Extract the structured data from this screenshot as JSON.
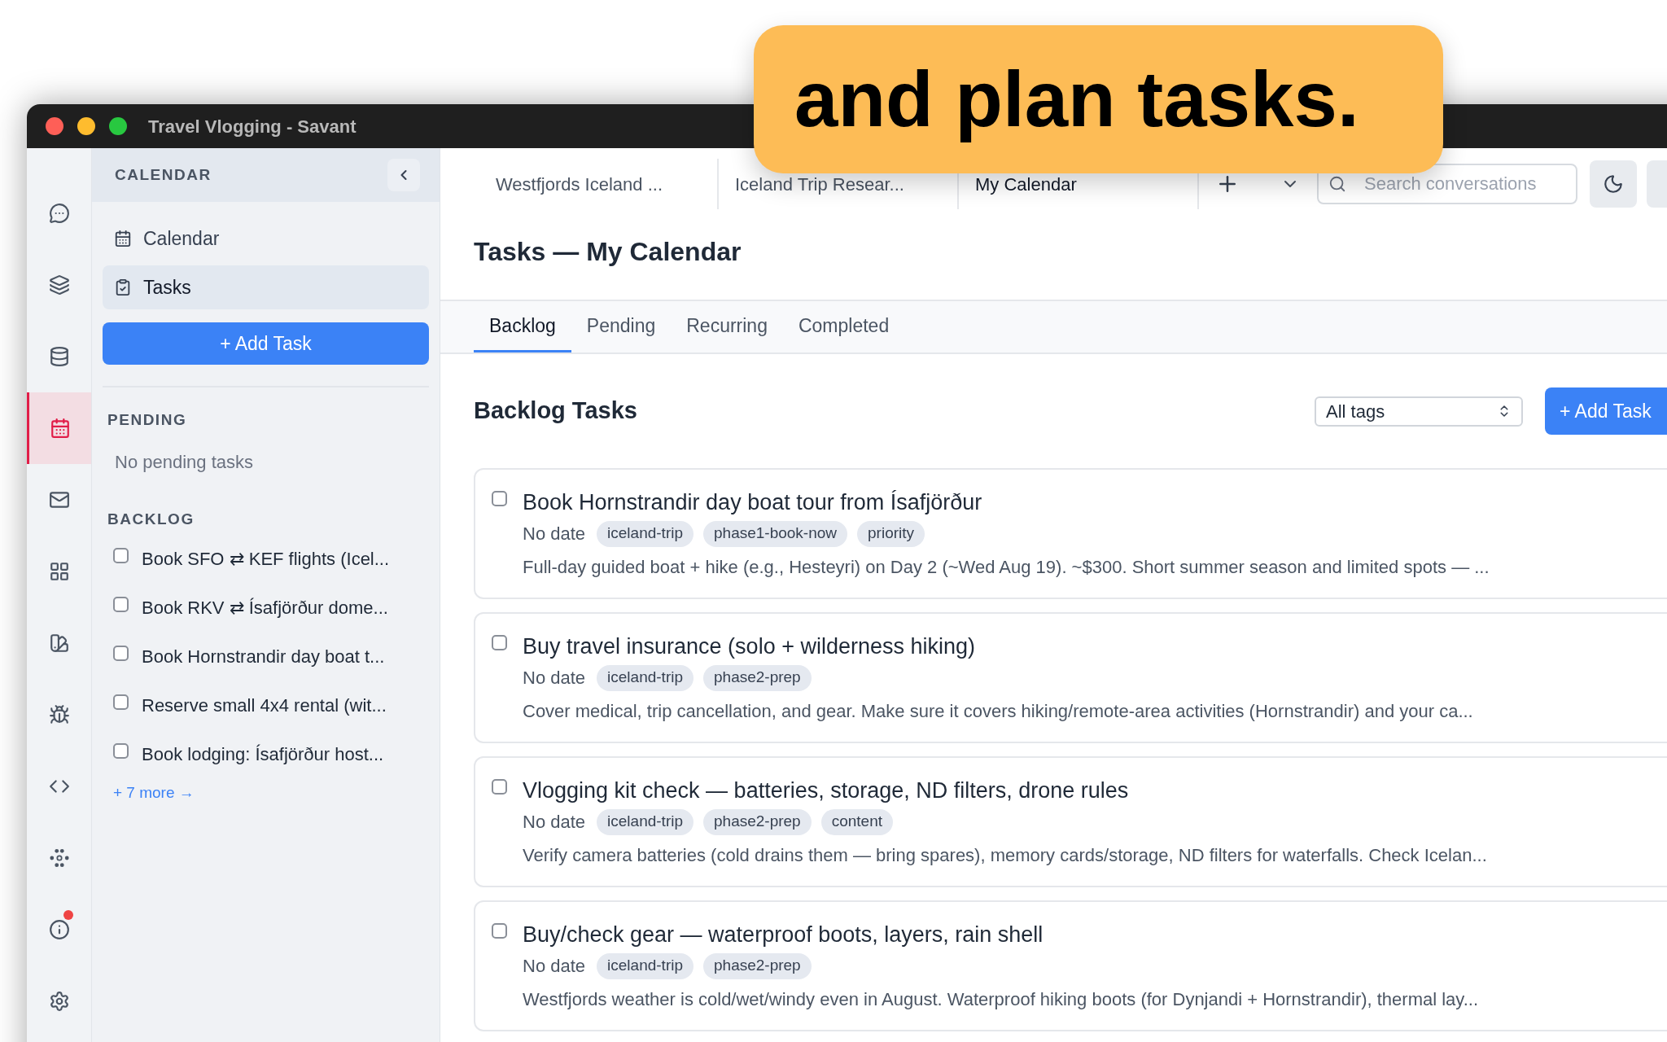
{
  "callout": {
    "text": "and plan tasks."
  },
  "window": {
    "title": "Travel Vlogging - Savant"
  },
  "rail": [
    {
      "kind": "chat",
      "selected": false,
      "notification": false
    },
    {
      "kind": "stack",
      "selected": false,
      "notification": false
    },
    {
      "kind": "database",
      "selected": false,
      "notification": false
    },
    {
      "kind": "calendar",
      "selected": true,
      "notification": false
    },
    {
      "kind": "mail",
      "selected": false,
      "notification": false
    },
    {
      "kind": "grid",
      "selected": false,
      "notification": false
    },
    {
      "kind": "swatches",
      "selected": false,
      "notification": false
    },
    {
      "kind": "bug",
      "selected": false,
      "notification": false
    },
    {
      "kind": "code",
      "selected": false,
      "notification": false
    },
    {
      "kind": "nodes",
      "selected": false,
      "notification": false
    },
    {
      "kind": "info",
      "selected": false,
      "notification": true
    },
    {
      "kind": "settings",
      "selected": false,
      "notification": false
    }
  ],
  "sidebar": {
    "header": "CALENDAR",
    "nav": [
      {
        "label": "Calendar",
        "kind": "calendar",
        "selected": false
      },
      {
        "label": "Tasks",
        "kind": "tasks",
        "selected": true
      }
    ],
    "add_button": "+ Add Task",
    "pending": {
      "heading": "PENDING",
      "empty": "No pending tasks"
    },
    "backlog": {
      "heading": "BACKLOG",
      "items": [
        {
          "label": "Book SFO ⇄ KEF flights (Icel...",
          "checked": false
        },
        {
          "label": "Book RKV ⇄ Ísafjörður dome...",
          "checked": false
        },
        {
          "label": "Book Hornstrandir day boat t...",
          "checked": false
        },
        {
          "label": "Reserve small 4x4 rental (wit...",
          "checked": false
        },
        {
          "label": "Book lodging: Ísafjörður host...",
          "checked": false
        }
      ],
      "more": "+ 7 more →"
    }
  },
  "tabs": [
    {
      "label": "Westfjords Iceland ...",
      "selected": false
    },
    {
      "label": "Iceland Trip Resear...",
      "selected": false
    },
    {
      "label": "My Calendar",
      "selected": true
    }
  ],
  "search": {
    "placeholder": "Search conversations"
  },
  "page_title": "Tasks — My Calendar",
  "subtabs": [
    {
      "label": "Backlog",
      "selected": true
    },
    {
      "label": "Pending",
      "selected": false
    },
    {
      "label": "Recurring",
      "selected": false
    },
    {
      "label": "Completed",
      "selected": false
    }
  ],
  "section": {
    "title": "Backlog Tasks",
    "filter": "All tags",
    "add_button": "+ Add Task"
  },
  "tasks": [
    {
      "title": "Book Hornstrandir day boat tour from Ísafjörður",
      "checked": false,
      "date": "No date",
      "tags": [
        "iceland-trip",
        "phase1-book-now",
        "priority"
      ],
      "description": "Full-day guided boat + hike (e.g., Hesteyri) on Day 2 (~Wed Aug 19). ~$300. Short summer season and limited spots — ..."
    },
    {
      "title": "Buy travel insurance (solo + wilderness hiking)",
      "checked": false,
      "date": "No date",
      "tags": [
        "iceland-trip",
        "phase2-prep"
      ],
      "description": "Cover medical, trip cancellation, and gear. Make sure it covers hiking/remote-area activities (Hornstrandir) and your ca..."
    },
    {
      "title": "Vlogging kit check — batteries, storage, ND filters, drone rules",
      "checked": false,
      "date": "No date",
      "tags": [
        "iceland-trip",
        "phase2-prep",
        "content"
      ],
      "description": "Verify camera batteries (cold drains them — bring spares), memory cards/storage, ND filters for waterfalls. Check Icelan..."
    },
    {
      "title": "Buy/check gear — waterproof boots, layers, rain shell",
      "checked": false,
      "date": "No date",
      "tags": [
        "iceland-trip",
        "phase2-prep"
      ],
      "description": "Westfjords weather is cold/wet/windy even in August. Waterproof hiking boots (for Dynjandi + Hornstrandir), thermal lay..."
    }
  ]
}
